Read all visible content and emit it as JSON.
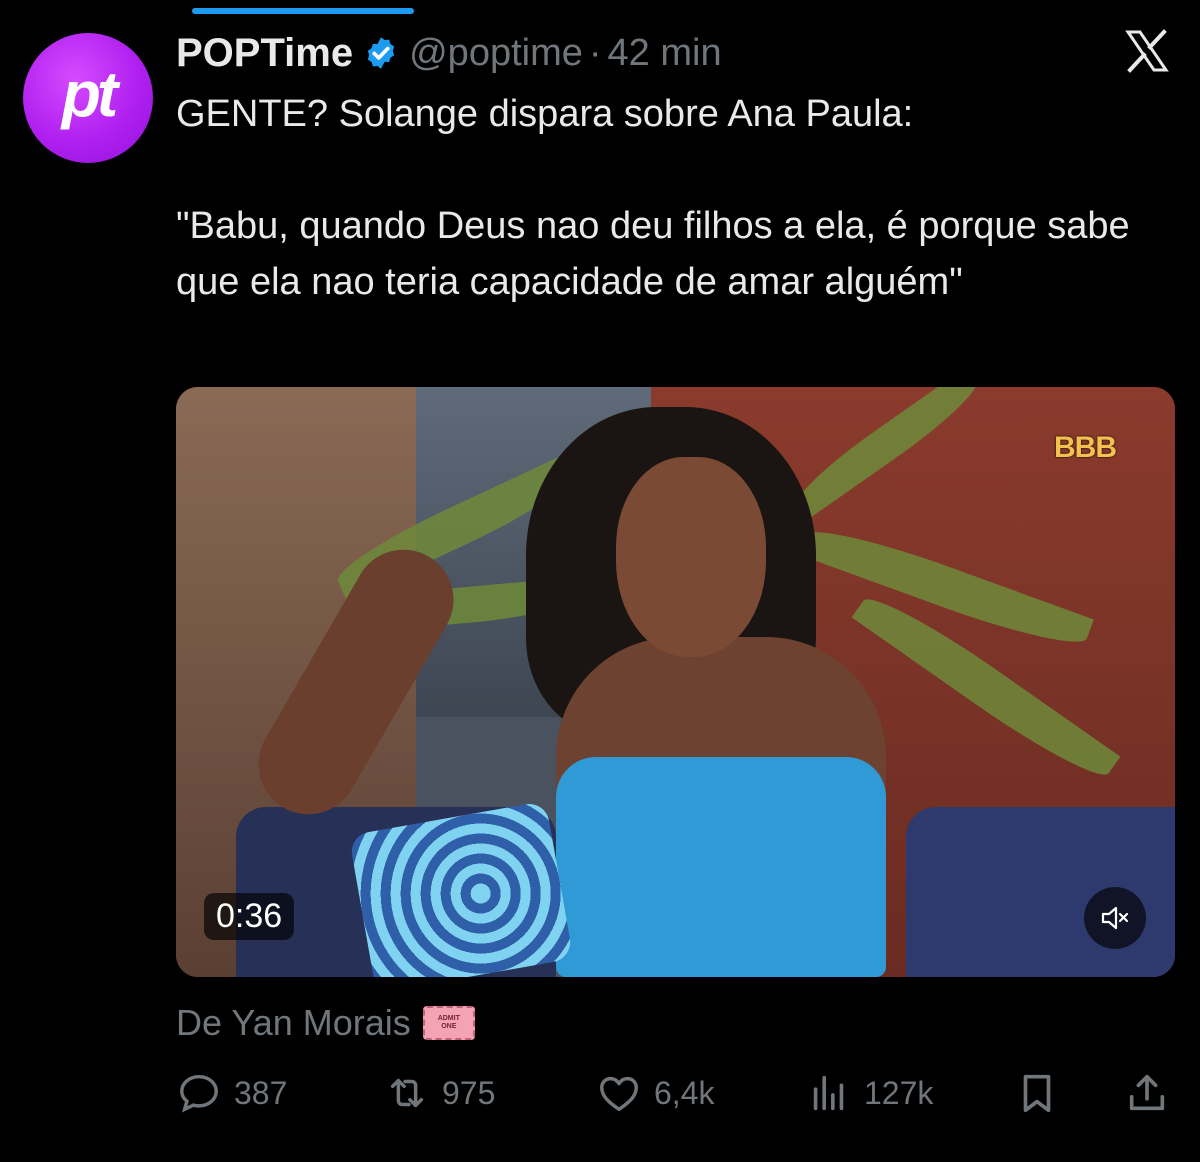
{
  "tweet": {
    "author": {
      "display_name": "POPTime",
      "handle": "@poptime",
      "separator": "·",
      "timestamp": "42 min",
      "avatar_text": "pt",
      "verified_color": "#1d9bf0",
      "avatar_color": "#b020f0"
    },
    "text": "GENTE? Solange dispara sobre Ana Paula:\n\n\"Babu, quando Deus nao deu filhos a ela, é porque sabe que ela nao teria capacidade de amar alguém\"",
    "media": {
      "type": "video",
      "duration": "0:36",
      "watermark": "BBB",
      "muted": true
    },
    "attribution": {
      "text": "De Yan Morais",
      "ticket_line1": "ADMIT",
      "ticket_line2": "ONE"
    },
    "metrics": {
      "replies": "387",
      "reposts": "975",
      "likes": "6,4k",
      "views": "127k"
    }
  },
  "icons": {
    "reply": "reply-icon",
    "repost": "repost-icon",
    "like": "heart-icon",
    "views": "views-icon",
    "bookmark": "bookmark-icon",
    "share": "share-icon",
    "platform": "x-logo-icon",
    "mute": "mute-icon"
  },
  "colors": {
    "background": "#000000",
    "text": "#e7e9ea",
    "secondary_text": "#71767b",
    "accent": "#1d9bf0"
  }
}
